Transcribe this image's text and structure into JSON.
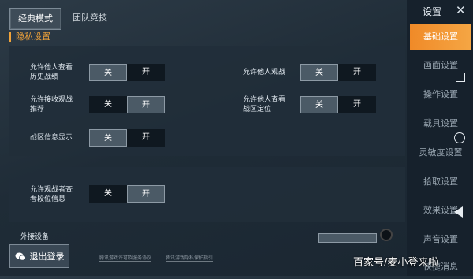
{
  "top_tabs": [
    {
      "label": "经典模式",
      "active": true
    },
    {
      "label": "团队竞技",
      "active": false
    }
  ],
  "section": {
    "title": "隐私设置"
  },
  "toggle_labels": {
    "off": "关",
    "on": "开"
  },
  "privacy_options": [
    {
      "label_line1": "允许他人查看",
      "label_line2": "历史战绩",
      "selected": "off"
    },
    {
      "label_line1": "允许他人观战",
      "label_line2": "",
      "selected": "off"
    },
    {
      "label_line1": "允许接收观战",
      "label_line2": "推荐",
      "selected": "on"
    },
    {
      "label_line1": "允许他人查看",
      "label_line2": "战区定位",
      "selected": "off"
    },
    {
      "label_line1": "战区信息显示",
      "label_line2": "",
      "selected": "off"
    },
    {
      "label_line1": "允许观战者查",
      "label_line2": "看段位信息",
      "selected": "on"
    }
  ],
  "external_device": {
    "label": "外接设备"
  },
  "settings_panel": {
    "title": "设置",
    "items": [
      {
        "label": "基础设置",
        "active": true
      },
      {
        "label": "画面设置",
        "active": false
      },
      {
        "label": "操作设置",
        "active": false
      },
      {
        "label": "载具设置",
        "active": false
      },
      {
        "label": "灵敏度设置",
        "active": false
      },
      {
        "label": "拾取设置",
        "active": false
      },
      {
        "label": "效果设置",
        "active": false
      },
      {
        "label": "声音设置",
        "active": false
      },
      {
        "label": "快捷消息",
        "active": false
      }
    ]
  },
  "logout": {
    "label": "退出登录",
    "icon": "wechat-icon"
  },
  "bottom_links": [
    "腾讯游戏许可及服务协议",
    "腾讯游戏隐私保护指引"
  ],
  "watermark": "百家号/麦小登来啦",
  "colors": {
    "accent": "#f08a28",
    "section_title": "#f0a33a"
  }
}
